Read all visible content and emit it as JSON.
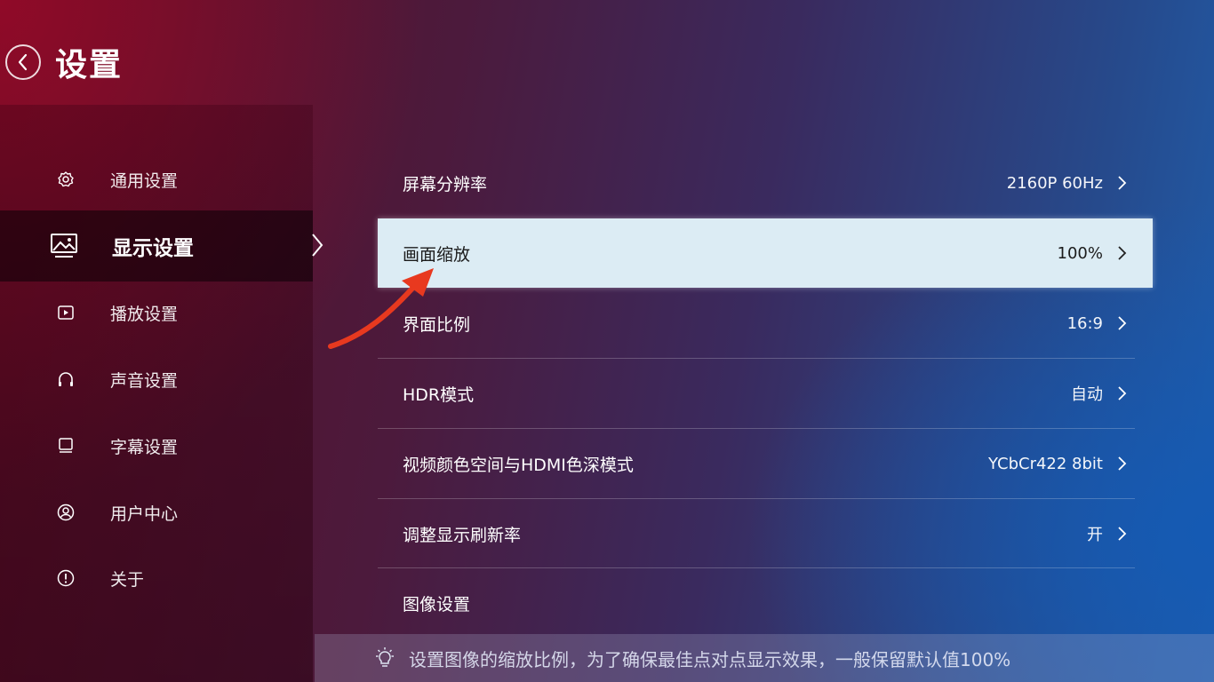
{
  "header": {
    "title": "设置"
  },
  "sidebar": {
    "items": [
      {
        "label": "通用设置",
        "icon": "gear-icon"
      },
      {
        "label": "显示设置",
        "icon": "image-icon",
        "active": true
      },
      {
        "label": "播放设置",
        "icon": "play-icon"
      },
      {
        "label": "声音设置",
        "icon": "headphones-icon"
      },
      {
        "label": "字幕设置",
        "icon": "monitor-icon"
      },
      {
        "label": "用户中心",
        "icon": "user-icon"
      },
      {
        "label": "关于",
        "icon": "info-icon"
      }
    ]
  },
  "settings": {
    "rows": [
      {
        "name": "屏幕分辨率",
        "value": "2160P 60Hz"
      },
      {
        "name": "画面缩放",
        "value": "100%",
        "selected": true
      },
      {
        "name": "界面比例",
        "value": "16:9"
      },
      {
        "name": "HDR模式",
        "value": "自动"
      },
      {
        "name": "视频颜色空间与HDMI色深模式",
        "value": "YCbCr422 8bit"
      },
      {
        "name": "调整显示刷新率",
        "value": "开"
      },
      {
        "name": "图像设置",
        "value": ""
      }
    ]
  },
  "hint": {
    "text": "设置图像的缩放比例，为了确保最佳点对点显示效果，一般保留默认值100%",
    "icon": "lightbulb-icon"
  },
  "colors": {
    "selected_row_bg": "#dcecf4",
    "annotation_arrow": "#e8391f"
  }
}
